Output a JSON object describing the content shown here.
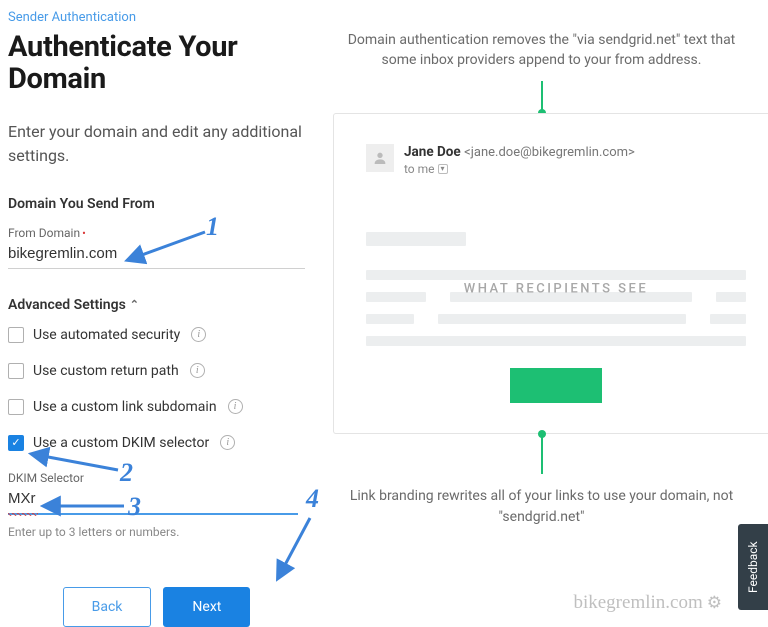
{
  "breadcrumb": "Sender Authentication",
  "title": "Authenticate Your Domain",
  "subhead": "Enter your domain and edit any additional settings.",
  "domain_section_label": "Domain You Send From",
  "from_domain": {
    "label": "From Domain",
    "value": "bikegremlin.com"
  },
  "advanced_label": "Advanced Settings",
  "options": {
    "auto_security": {
      "label": "Use automated security",
      "checked": false
    },
    "return_path": {
      "label": "Use custom return path",
      "checked": false
    },
    "link_sub": {
      "label": "Use a custom link subdomain",
      "checked": false
    },
    "dkim": {
      "label": "Use a custom DKIM selector",
      "checked": true
    }
  },
  "dkim_selector": {
    "label": "DKIM Selector",
    "value": "MXr",
    "helper": "Enter up to 3 letters or numbers."
  },
  "buttons": {
    "back": "Back",
    "next": "Next"
  },
  "right": {
    "intro": "Domain authentication removes the \"via sendgrid.net\" text that some inbox providers append to your from address.",
    "sender_name": "Jane Doe",
    "sender_email": "<jane.doe@bikegremlin.com>",
    "to_line": "to me",
    "recipients_label": "WHAT RECIPIENTS SEE",
    "outro": "Link branding rewrites all of your links to use your domain, not \"sendgrid.net\""
  },
  "annotations": {
    "a1": "1",
    "a2": "2",
    "a3": "3",
    "a4": "4"
  },
  "watermark": "bikegremlin.com",
  "feedback": "Feedback"
}
